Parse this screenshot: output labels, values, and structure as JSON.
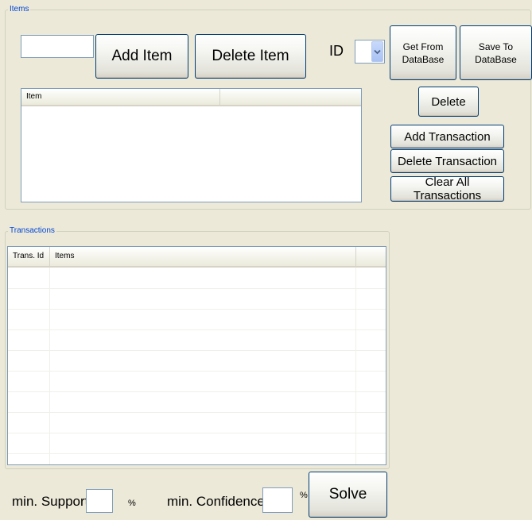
{
  "items_group": {
    "legend": "Items",
    "item_input_value": "",
    "add_item_label": "Add Item",
    "delete_item_label": "Delete Item",
    "id_label": "ID",
    "id_combo_value": "",
    "get_from_db_label": "Get From DataBase",
    "save_to_db_label": "Save To DataBase",
    "delete_label": "Delete",
    "add_transaction_label": "Add Transaction",
    "delete_transaction_label": "Delete Transaction",
    "clear_all_label": "Clear All Transactions",
    "items_list": {
      "columns": [
        "Item",
        ""
      ],
      "rows": []
    }
  },
  "transactions_group": {
    "legend": "Transactions",
    "table": {
      "columns": [
        "Trans. Id",
        "Items",
        ""
      ],
      "rows": []
    }
  },
  "footer": {
    "min_support_label": "min. Support",
    "min_support_value": "",
    "support_unit": "%",
    "min_confidence_label": "min. Confidence",
    "min_confidence_value": "",
    "confidence_unit": "%",
    "solve_label": "Solve"
  },
  "icons": {
    "combo_arrow": "chevron-down-icon"
  },
  "colors": {
    "form_background": "#ece9d8",
    "legend_text": "#0046d5",
    "button_border": "#003c74",
    "input_border": "#7f9db9"
  }
}
